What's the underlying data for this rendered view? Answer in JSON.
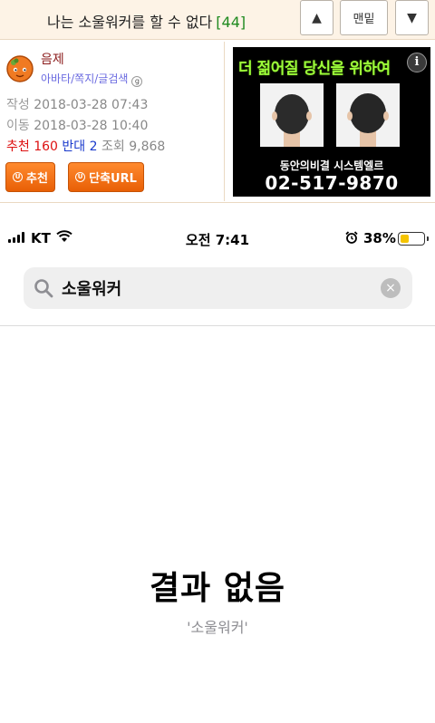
{
  "topbar": {
    "title": "나는 소울워커를 할 수 없다",
    "comment_count": "[44]",
    "up_arrow": "▲",
    "top_label": "맨밑",
    "down_arrow": "▼"
  },
  "author": {
    "nickname": "음제",
    "links": "아바타/쪽지/글검색",
    "mini_badge": "g",
    "created_label": "작성",
    "created": "2018-03-28 07:43",
    "moved_label": "이동",
    "moved": "2018-03-28 10:40",
    "recommend_label": "추천",
    "recommend": "160",
    "oppose_label": "반대",
    "oppose": "2",
    "views_label": "조회",
    "views": "9,868",
    "recommend_button": "추천",
    "short_url_button": "단축URL",
    "button_icon": "U"
  },
  "ad": {
    "headline": "더 젊어질 당신을 위하여",
    "info": "i",
    "clinic": "동안의비결 시스템엘르",
    "phone": "02-517-9870"
  },
  "status_bar": {
    "carrier": "KT",
    "time": "오전 7:41",
    "battery_percent": "38%",
    "battery_level": 0.38
  },
  "search": {
    "query": "소울워커",
    "clear_glyph": "×"
  },
  "results": {
    "empty_title": "결과 없음",
    "empty_query": "'소울워커'"
  },
  "colors": {
    "forum_bar_bg": "#fdf3e6",
    "accent_orange": "#ee6a0a",
    "ad_headline": "#9dff3a",
    "battery_fill": "#f5c400"
  }
}
